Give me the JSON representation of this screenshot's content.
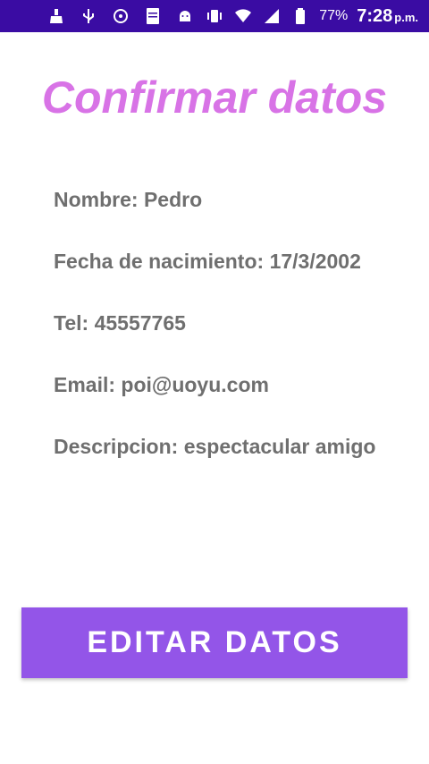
{
  "status_bar": {
    "icons": [
      "cleaner-icon",
      "usb-icon",
      "media-sync-icon",
      "holy-bible-app-icon",
      "android-debug-icon",
      "vibrate-icon",
      "wifi-icon",
      "cell-signal-icon",
      "battery-icon"
    ],
    "battery_percent": "77%",
    "time": "7:28",
    "ampm": "p.m.",
    "background_color": "#3a0ca3"
  },
  "page": {
    "title": "Confirmar datos",
    "title_color": "#d873e6"
  },
  "details": [
    {
      "label": "Nombre:",
      "value": "Pedro"
    },
    {
      "label": "Fecha de nacimiento:",
      "value": "17/3/2002"
    },
    {
      "label": "Tel:",
      "value": "45557765"
    },
    {
      "label": "Email:",
      "value": "poi@uoyu.com"
    },
    {
      "label": "Descripcion:",
      "value": "espectacular amigo"
    }
  ],
  "actions": {
    "edit_label": "EDITAR DATOS",
    "edit_color": "#9355e8"
  }
}
